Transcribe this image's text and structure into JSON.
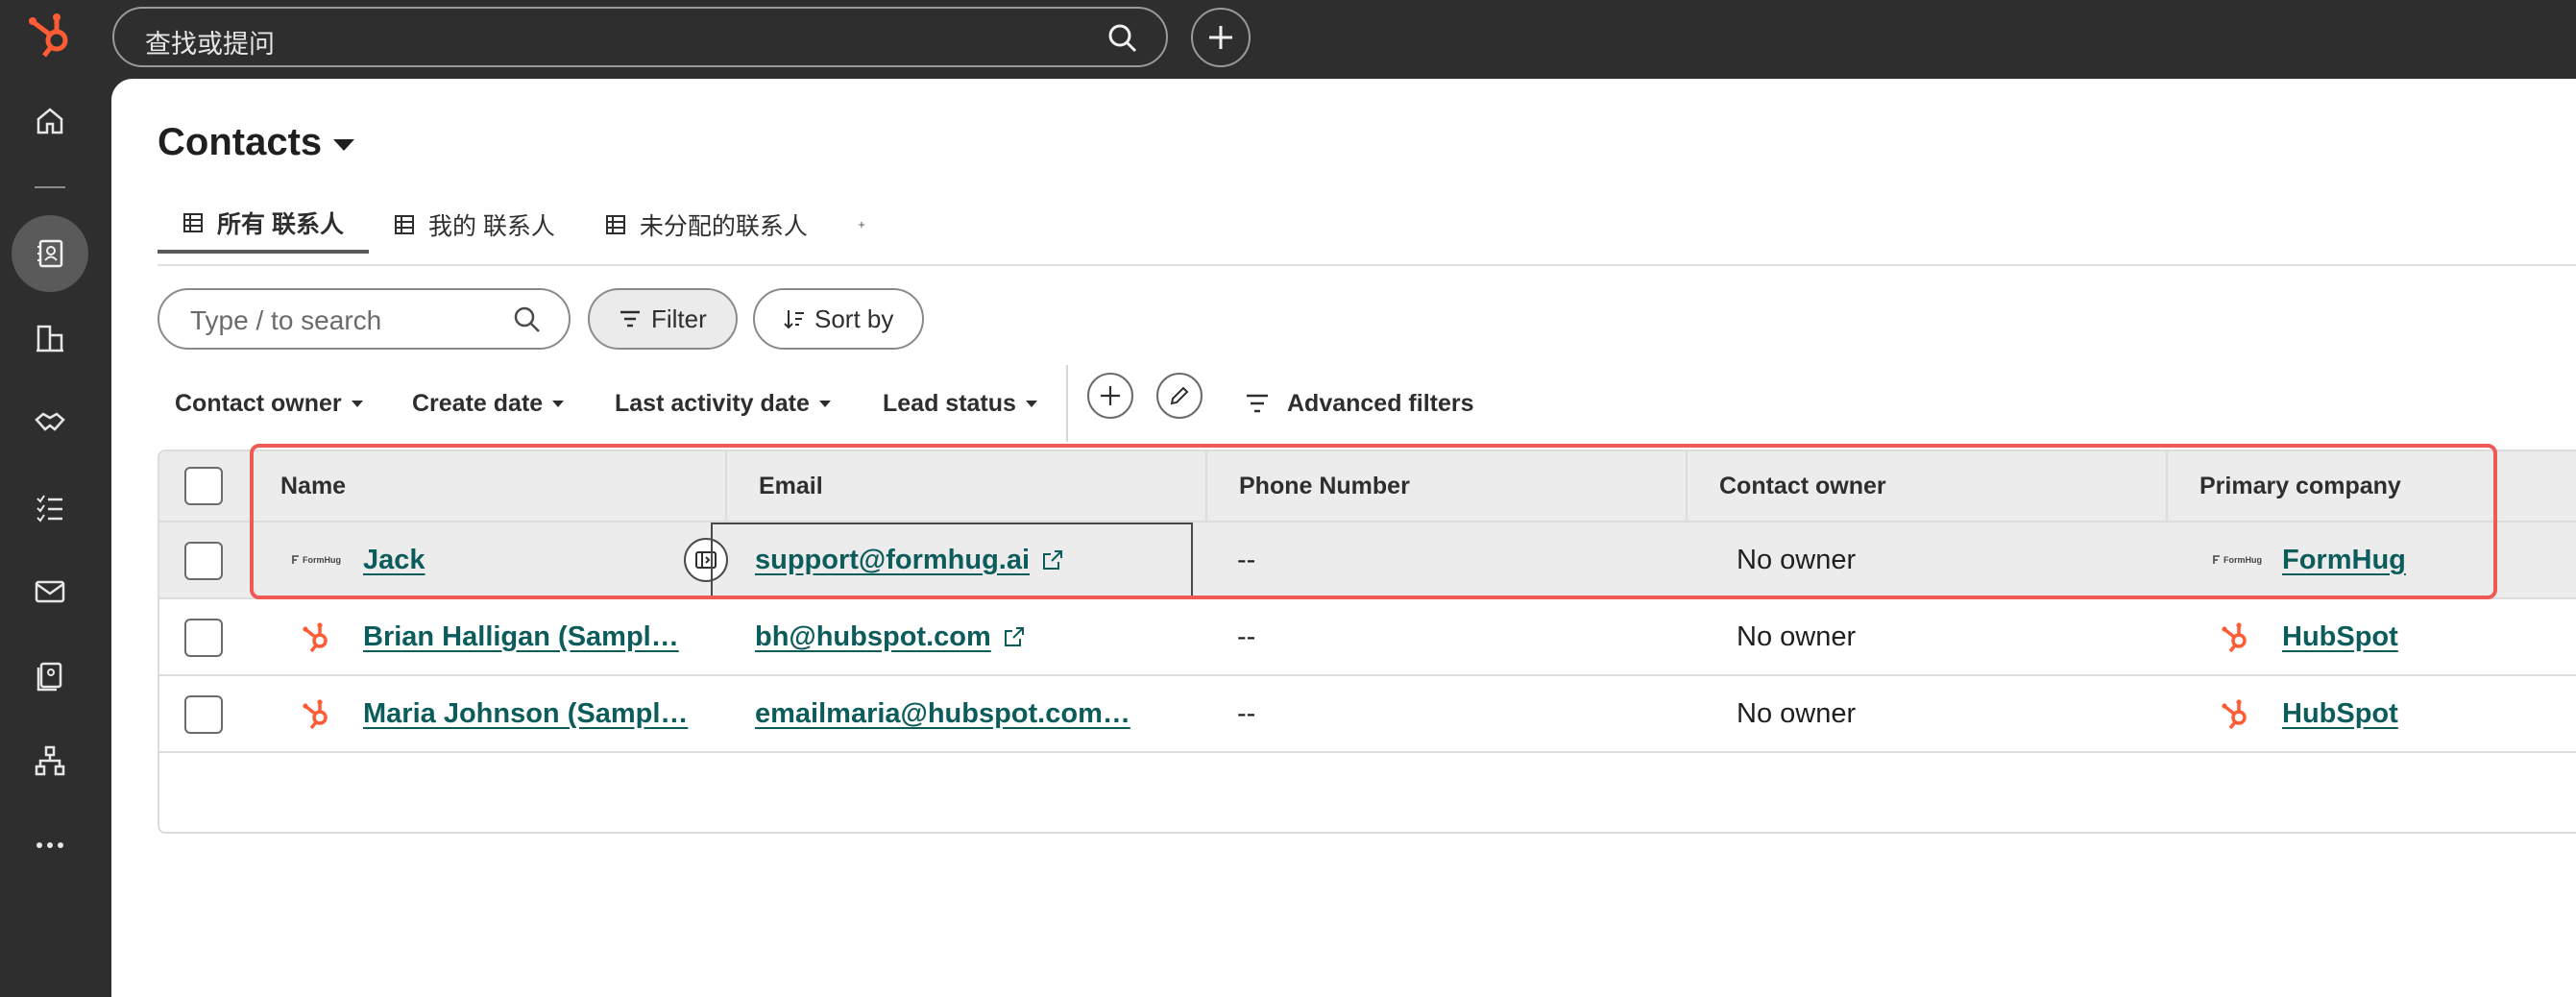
{
  "topbar": {
    "search_placeholder": "查找或提问"
  },
  "page": {
    "title": "Contacts"
  },
  "tabs": [
    {
      "label": "所有 联系人",
      "active": true
    },
    {
      "label": "我的 联系人",
      "active": false
    },
    {
      "label": "未分配的联系人",
      "active": false
    }
  ],
  "toolbar": {
    "search_placeholder": "Type / to search",
    "filter_label": "Filter",
    "sort_label": "Sort by"
  },
  "quick_filters": {
    "contact_owner": "Contact owner",
    "create_date": "Create date",
    "last_activity": "Last activity date",
    "lead_status": "Lead status",
    "advanced": "Advanced filters"
  },
  "table": {
    "columns": [
      "Name",
      "Email",
      "Phone Number",
      "Contact owner",
      "Primary company"
    ],
    "rows": [
      {
        "name": "Jack",
        "email": "support@formhug.ai",
        "phone": "--",
        "owner": "No owner",
        "company": "FormHug",
        "logo": "formhug"
      },
      {
        "name": "Brian Halligan (Sampl…",
        "email": "bh@hubspot.com",
        "phone": "--",
        "owner": "No owner",
        "company": "HubSpot",
        "logo": "hubspot"
      },
      {
        "name": "Maria Johnson (Sampl…",
        "email": "emailmaria@hubspot.com…",
        "phone": "--",
        "owner": "No owner",
        "company": "HubSpot",
        "logo": "hubspot"
      }
    ],
    "formhug_logo_text": "FormHug"
  },
  "colors": {
    "accent_link": "#0d5c5c",
    "hubspot_orange": "#ff5c35",
    "highlight_red": "#ef5a57"
  }
}
